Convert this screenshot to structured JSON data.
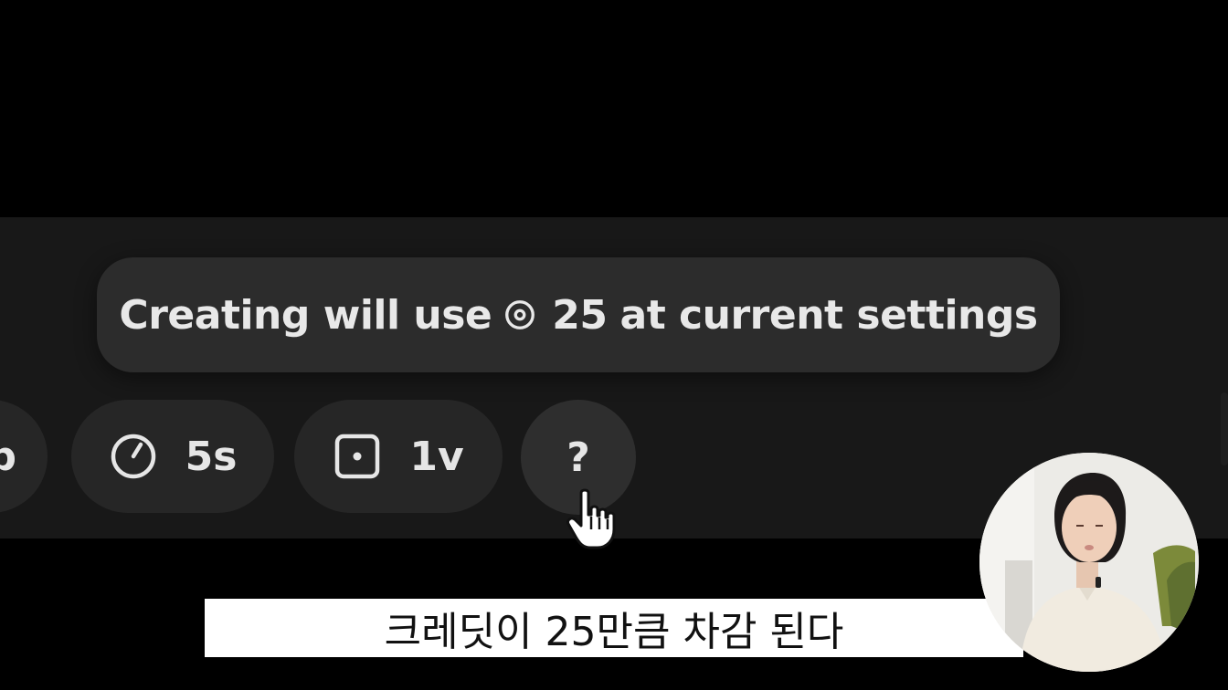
{
  "tooltip": {
    "before_icon": "Creating will use",
    "credit_amount": "25",
    "after_amount": "at current settings"
  },
  "toolbar": {
    "partial_pill_label": "p",
    "duration_label": "5s",
    "variations_label": "1v",
    "help_label": "?"
  },
  "icons": {
    "credit": "credit-coin-icon",
    "duration": "stopwatch-icon",
    "variations": "square-dot-icon",
    "cursor": "hand-pointer-cursor-icon"
  },
  "subtitle": {
    "text": "크레딧이 25만큼 차감 된다"
  },
  "colors": {
    "background": "#000000",
    "toolbar_band": "#181818",
    "pill": "#262626",
    "tooltip": "#2c2c2c",
    "text": "#e8e8e8",
    "subtitle_bg": "#ffffff",
    "subtitle_text": "#111111"
  }
}
